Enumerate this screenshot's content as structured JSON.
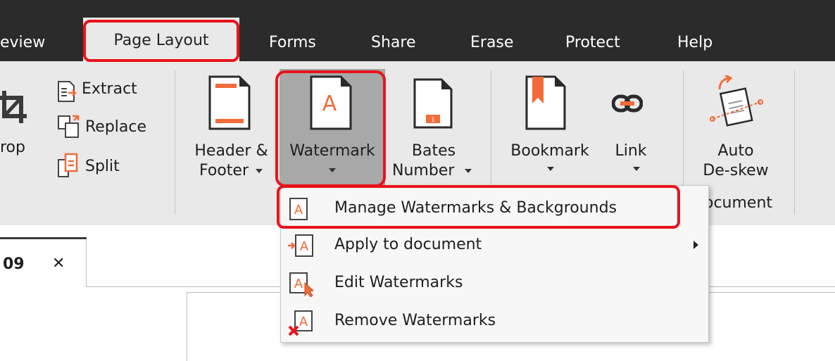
{
  "tabs": {
    "review": "eview",
    "page_layout": "Page Layout",
    "forms": "Forms",
    "share": "Share",
    "erase": "Erase",
    "protect": "Protect",
    "help": "Help"
  },
  "ribbon": {
    "crop_label": "rop",
    "extract_label": "Extract",
    "replace_label": "Replace",
    "split_label": "Split",
    "header_footer_line1": "Header &",
    "header_footer_line2": "Footer",
    "watermark_label": "Watermark",
    "bates_line1": "Bates",
    "bates_line2": "Number",
    "bookmark_label": "Bookmark",
    "link_label": "Link",
    "auto_deskew_line1": "Auto",
    "auto_deskew_line2": "De-skew",
    "group_document_label": "ocument"
  },
  "document_tab": {
    "label": "09",
    "close_glyph": "✕"
  },
  "watermark_menu": {
    "items": [
      {
        "label": "Manage Watermarks & Backgrounds"
      },
      {
        "label": "Apply to document"
      },
      {
        "label": "Edit Watermarks"
      },
      {
        "label": "Remove Watermarks"
      }
    ]
  },
  "colors": {
    "accent": "#f26b3a",
    "highlight": "#e8141b",
    "tab_bar": "#2b2b2b",
    "ribbon": "#e9e9e9"
  }
}
